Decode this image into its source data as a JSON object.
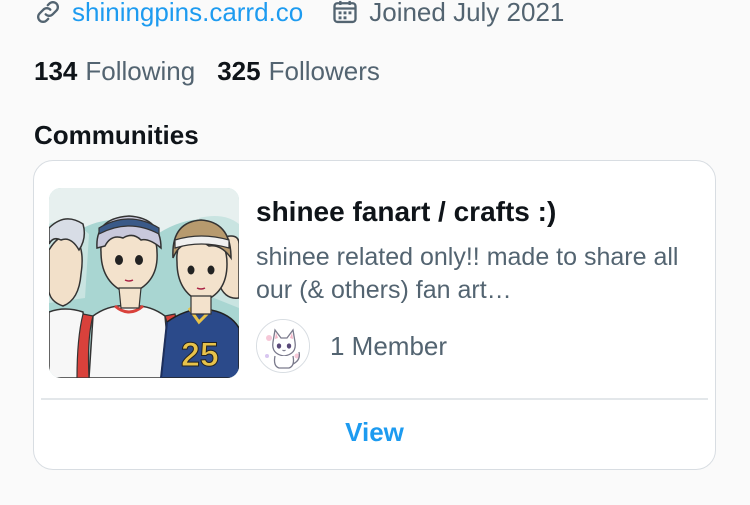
{
  "profile": {
    "website": {
      "icon": "link-icon",
      "text": "shiningpins.carrd.co"
    },
    "joined": {
      "icon": "calendar-icon",
      "text": "Joined July 2021"
    },
    "following": {
      "count": "134",
      "label": "Following"
    },
    "followers": {
      "count": "325",
      "label": "Followers"
    }
  },
  "communities": {
    "title": "Communities",
    "items": [
      {
        "name": "shinee fanart / crafts :)",
        "description": "shinee related only!! made to share all our (& others) fan art…",
        "thumbnail": "fanart-illustration",
        "member_avatar": "cat-avatar",
        "member_count": "1 Member",
        "view_label": "View"
      }
    ]
  },
  "colors": {
    "accent": "#1d9bf0",
    "text_primary": "#0f1419",
    "text_secondary": "#536471",
    "border": "#d8dde2",
    "background": "#fafafa"
  }
}
